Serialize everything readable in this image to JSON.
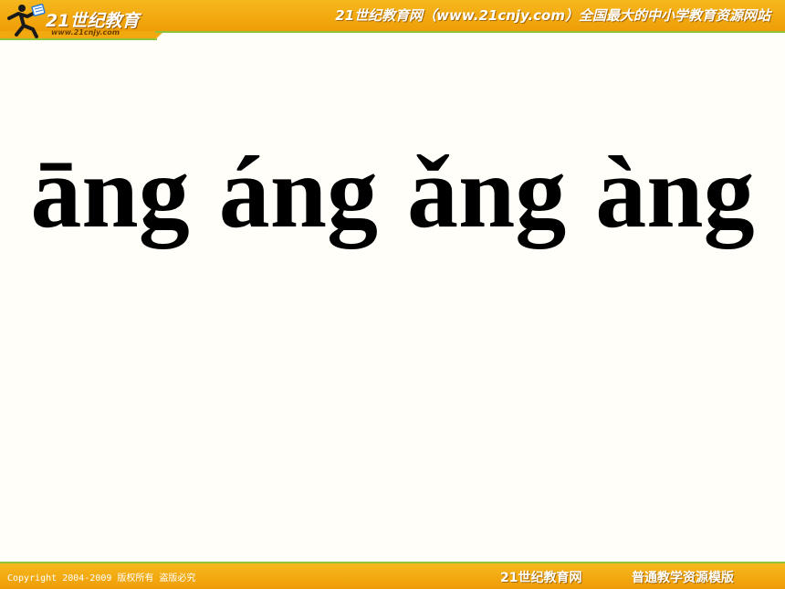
{
  "header": {
    "logo_name": "21世纪教育",
    "logo_url": "www.21cnjy.com",
    "slogan": "21世纪教育网（www.21cnjy.com）全国最大的中小学教育资源网站"
  },
  "content": {
    "syllables": [
      "āng",
      "áng",
      "ǎng",
      "àng"
    ]
  },
  "footer": {
    "copyright": "Copyright 2004-2009 版权所有 盗版必究",
    "brand": "21世纪教育网",
    "tagline": "普通教学资源模版"
  },
  "colors": {
    "band": "#f2a80f",
    "accent_line": "#8fc43a",
    "background": "#fffef9",
    "text": "#000000"
  }
}
